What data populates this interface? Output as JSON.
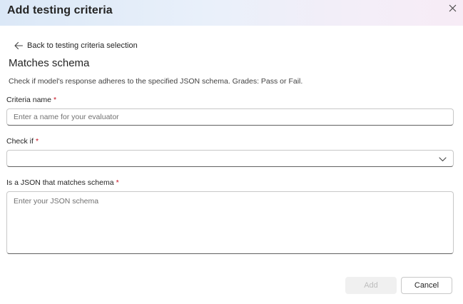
{
  "dialog": {
    "title": "Add testing criteria",
    "close_icon": "close-icon"
  },
  "back_link": {
    "icon": "arrow-left-icon",
    "label": "Back to testing criteria selection"
  },
  "section": {
    "title": "Matches schema",
    "description": "Check if model's response adheres to the specified JSON schema. Grades: Pass or Fail."
  },
  "fields": {
    "criteria_name": {
      "label": "Criteria name",
      "required_mark": "*",
      "value": "",
      "placeholder": "Enter a name for your evaluator"
    },
    "check_if": {
      "label": "Check if",
      "required_mark": "*",
      "selected_value": "",
      "icon": "chevron-down-icon"
    },
    "json_schema": {
      "label": "Is a JSON that matches schema",
      "required_mark": "*",
      "value": "",
      "placeholder": "Enter your JSON schema"
    }
  },
  "buttons": {
    "add_label": "Add",
    "add_disabled": true,
    "cancel_label": "Cancel"
  },
  "colors": {
    "required": "#c50f1f",
    "header_gradient_start": "#dbe8f7",
    "header_gradient_end": "#f7ecf6",
    "disabled_button_bg": "#f0f0f0",
    "disabled_button_text": "#bdbdbd"
  }
}
